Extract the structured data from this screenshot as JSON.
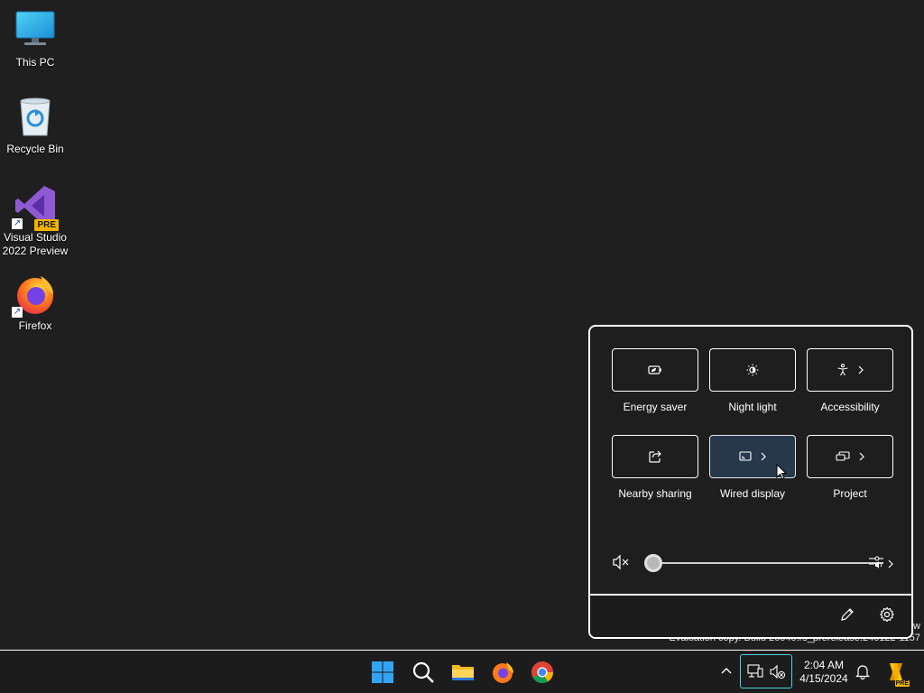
{
  "desktop": {
    "icons": [
      {
        "label": "This PC",
        "icon": "computer-icon"
      },
      {
        "label": "Recycle Bin",
        "icon": "recycle-bin-icon"
      },
      {
        "label": "Visual Studio 2022 Preview",
        "icon": "visual-studio-icon",
        "badge": "PRE"
      },
      {
        "label": "Firefox",
        "icon": "firefox-icon"
      }
    ]
  },
  "watermark": {
    "line1": "w",
    "line2": "Evaluation copy. Build 26040.rs_prerelease.240122-1157"
  },
  "quick_settings": {
    "tiles": [
      {
        "label": "Energy saver",
        "icon": "battery-leaf-icon",
        "active": false,
        "chevron": false
      },
      {
        "label": "Night light",
        "icon": "night-light-icon",
        "active": false,
        "chevron": false
      },
      {
        "label": "Accessibility",
        "icon": "accessibility-icon",
        "active": false,
        "chevron": true
      },
      {
        "label": "Nearby sharing",
        "icon": "share-icon",
        "active": false,
        "chevron": false
      },
      {
        "label": "Wired display",
        "icon": "cast-icon",
        "active": true,
        "chevron": true
      },
      {
        "label": "Project",
        "icon": "project-icon",
        "active": false,
        "chevron": true
      }
    ],
    "volume": {
      "level": 0,
      "muted": true
    },
    "footer": {
      "edit_icon": "pencil-icon",
      "settings_icon": "gear-icon"
    }
  },
  "taskbar": {
    "apps": [
      "start-icon",
      "search-icon",
      "file-explorer-icon",
      "firefox-icon",
      "chrome-icon"
    ],
    "clock": {
      "time": "2:04 AM",
      "date": "4/15/2024"
    },
    "copilot_badge": "PRE"
  },
  "colors": {
    "desktop_bg": "#1f1f1f",
    "active_tile": "#26384a",
    "tray_highlight": "#4fd0e0",
    "start_blue": "#33a4f3"
  }
}
